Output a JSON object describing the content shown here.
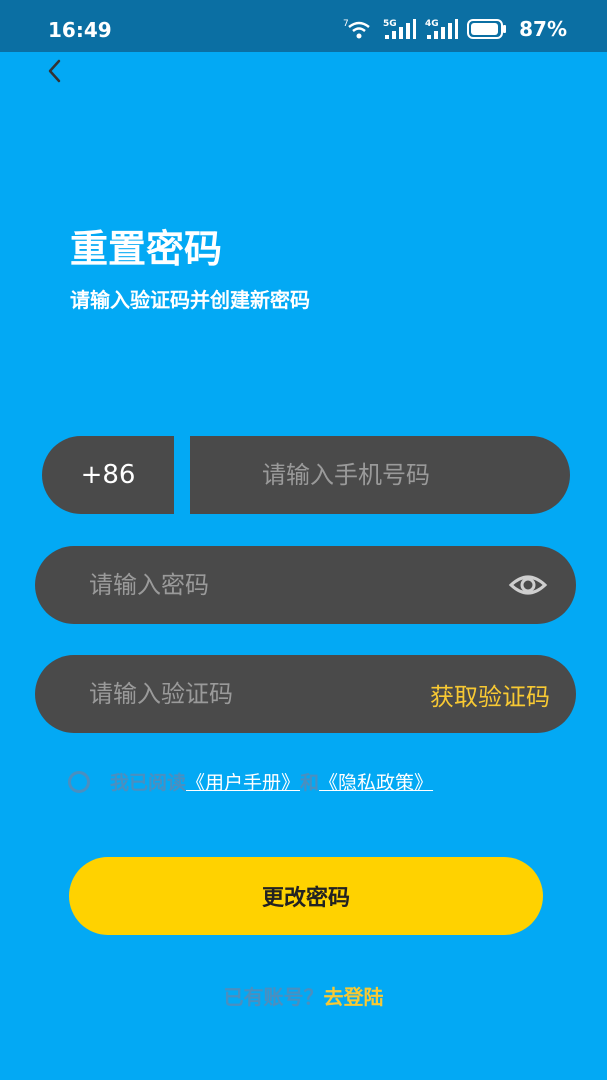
{
  "status_bar": {
    "time": "16:49",
    "wifi_badge": "7",
    "signal1_label": "5G",
    "signal2_label": "4G",
    "battery": "87%"
  },
  "header": {
    "title": "重置密码",
    "subtitle": "请输入验证码并创建新密码"
  },
  "form": {
    "country_code": "+86",
    "phone_placeholder": "请输入手机号码",
    "password_placeholder": "请输入密码",
    "code_placeholder": "请输入验证码",
    "get_code_label": "获取验证码"
  },
  "agreement": {
    "prefix": "我已阅读",
    "user_manual": "《用户手册》",
    "and": "和",
    "privacy": "《隐私政策》"
  },
  "submit_label": "更改密码",
  "login": {
    "prompt": "已有账号？",
    "link": "去登陆"
  },
  "colors": {
    "background": "#03a9f4",
    "status_bar": "#0b6fa3",
    "field": "#4a4a4a",
    "accent_yellow": "#ffd200",
    "link_yellow": "#f8c933"
  },
  "icons": [
    "back-chevron-icon",
    "wifi-icon",
    "signal-icon",
    "battery-icon",
    "eye-icon"
  ]
}
